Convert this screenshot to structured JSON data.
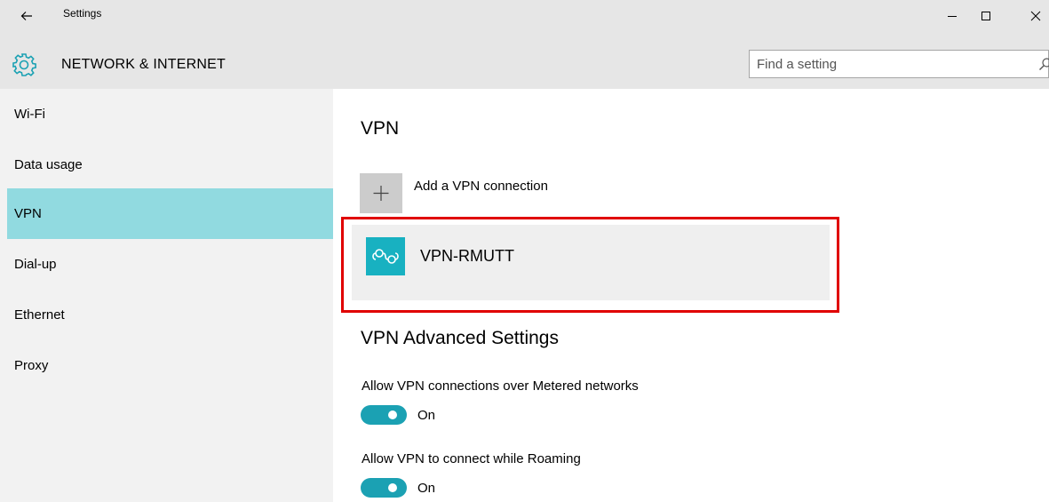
{
  "window": {
    "title": "Settings",
    "back_icon": "arrow-left-icon",
    "controls": [
      "minimize-icon",
      "maximize-icon",
      "close-icon"
    ]
  },
  "header": {
    "icon": "gear-icon",
    "section_title": "NETWORK & INTERNET",
    "search": {
      "placeholder": "Find a setting",
      "value": "",
      "icon": "search-icon"
    }
  },
  "sidebar": {
    "items": [
      {
        "label": "Wi-Fi",
        "active": false
      },
      {
        "label": "Data usage",
        "active": false
      },
      {
        "label": "VPN",
        "active": true
      },
      {
        "label": "Dial-up",
        "active": false
      },
      {
        "label": "Ethernet",
        "active": false
      },
      {
        "label": "Proxy",
        "active": false
      }
    ],
    "active_color": "#91dae0"
  },
  "main": {
    "title": "VPN",
    "add_connection": {
      "label": "Add a VPN connection",
      "icon": "plus-icon"
    },
    "connections": [
      {
        "name": "VPN-RMUTT",
        "icon": "vpn-icon",
        "icon_color": "#18b1c1"
      }
    ],
    "highlight_color": "#e00000",
    "advanced": {
      "title": "VPN Advanced Settings",
      "settings": [
        {
          "label": "Allow VPN connections over Metered networks",
          "state": "On",
          "on": true
        },
        {
          "label": "Allow VPN to connect while Roaming",
          "state": "On",
          "on": true
        }
      ]
    },
    "accent_color": "#1ba1b3"
  }
}
